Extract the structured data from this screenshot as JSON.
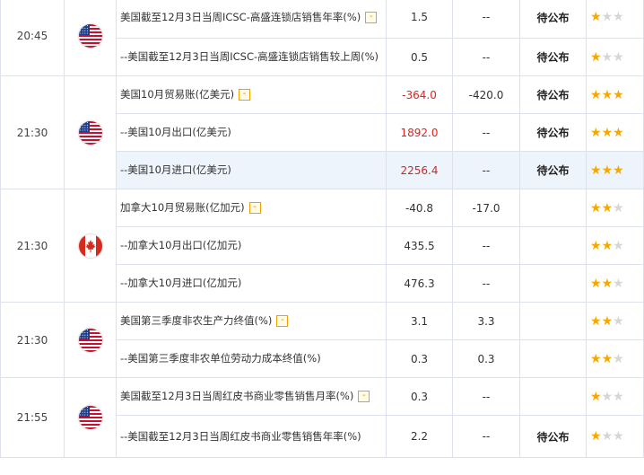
{
  "status_label": "待公布",
  "colors": {
    "red": "#d9251d",
    "star_on": "#f6a800",
    "star_off": "#d6d6d6",
    "highlight": "#eef4fc"
  },
  "groups": [
    {
      "time": "20:45",
      "country": "us",
      "flag_icon": "us-flag-icon",
      "rows": [
        {
          "event": "美国截至12月3日当周ICSC-高盛连锁店销售年率(%)",
          "expandable": true,
          "actual": "1.5",
          "previous": "--",
          "status": "待公布",
          "stars": 1,
          "red": false
        },
        {
          "event": "--美国截至12月3日当周ICSC-高盛连锁店销售较上周(%)",
          "expandable": false,
          "actual": "0.5",
          "previous": "--",
          "status": "待公布",
          "stars": 1,
          "red": false
        }
      ]
    },
    {
      "time": "21:30",
      "country": "us",
      "flag_icon": "us-flag-icon",
      "rows": [
        {
          "event": "美国10月贸易账(亿美元)",
          "expandable": true,
          "actual": "-364.0",
          "previous": "-420.0",
          "status": "待公布",
          "stars": 3,
          "red": true
        },
        {
          "event": "--美国10月出口(亿美元)",
          "expandable": false,
          "actual": "1892.0",
          "previous": "--",
          "status": "待公布",
          "stars": 3,
          "red": true
        },
        {
          "event": "--美国10月进口(亿美元)",
          "expandable": false,
          "actual": "2256.4",
          "previous": "--",
          "status": "待公布",
          "stars": 3,
          "red": true,
          "highlight": true
        }
      ]
    },
    {
      "time": "21:30",
      "country": "ca",
      "flag_icon": "canada-flag-icon",
      "rows": [
        {
          "event": "加拿大10月贸易账(亿加元)",
          "expandable": true,
          "actual": "-40.8",
          "previous": "-17.0",
          "status": "",
          "stars": 2,
          "red": false
        },
        {
          "event": "--加拿大10月出口(亿加元)",
          "expandable": false,
          "actual": "435.5",
          "previous": "--",
          "status": "",
          "stars": 2,
          "red": false
        },
        {
          "event": "--加拿大10月进口(亿加元)",
          "expandable": false,
          "actual": "476.3",
          "previous": "--",
          "status": "",
          "stars": 2,
          "red": false
        }
      ]
    },
    {
      "time": "21:30",
      "country": "us",
      "flag_icon": "us-flag-icon",
      "rows": [
        {
          "event": "美国第三季度非农生产力终值(%)",
          "expandable": true,
          "actual": "3.1",
          "previous": "3.3",
          "status": "",
          "stars": 2,
          "red": false
        },
        {
          "event": "--美国第三季度非农单位劳动力成本终值(%)",
          "expandable": false,
          "actual": "0.3",
          "previous": "0.3",
          "status": "",
          "stars": 2,
          "red": false
        }
      ]
    },
    {
      "time": "21:55",
      "country": "us",
      "flag_icon": "us-flag-icon",
      "rows": [
        {
          "event": "美国截至12月3日当周红皮书商业零售销售月率(%)",
          "expandable": true,
          "actual": "0.3",
          "previous": "--",
          "status": "",
          "stars": 1,
          "red": false
        },
        {
          "event": "--美国截至12月3日当周红皮书商业零售销售年率(%)",
          "expandable": false,
          "actual": "2.2",
          "previous": "--",
          "status": "待公布",
          "stars": 1,
          "red": false
        }
      ]
    }
  ]
}
